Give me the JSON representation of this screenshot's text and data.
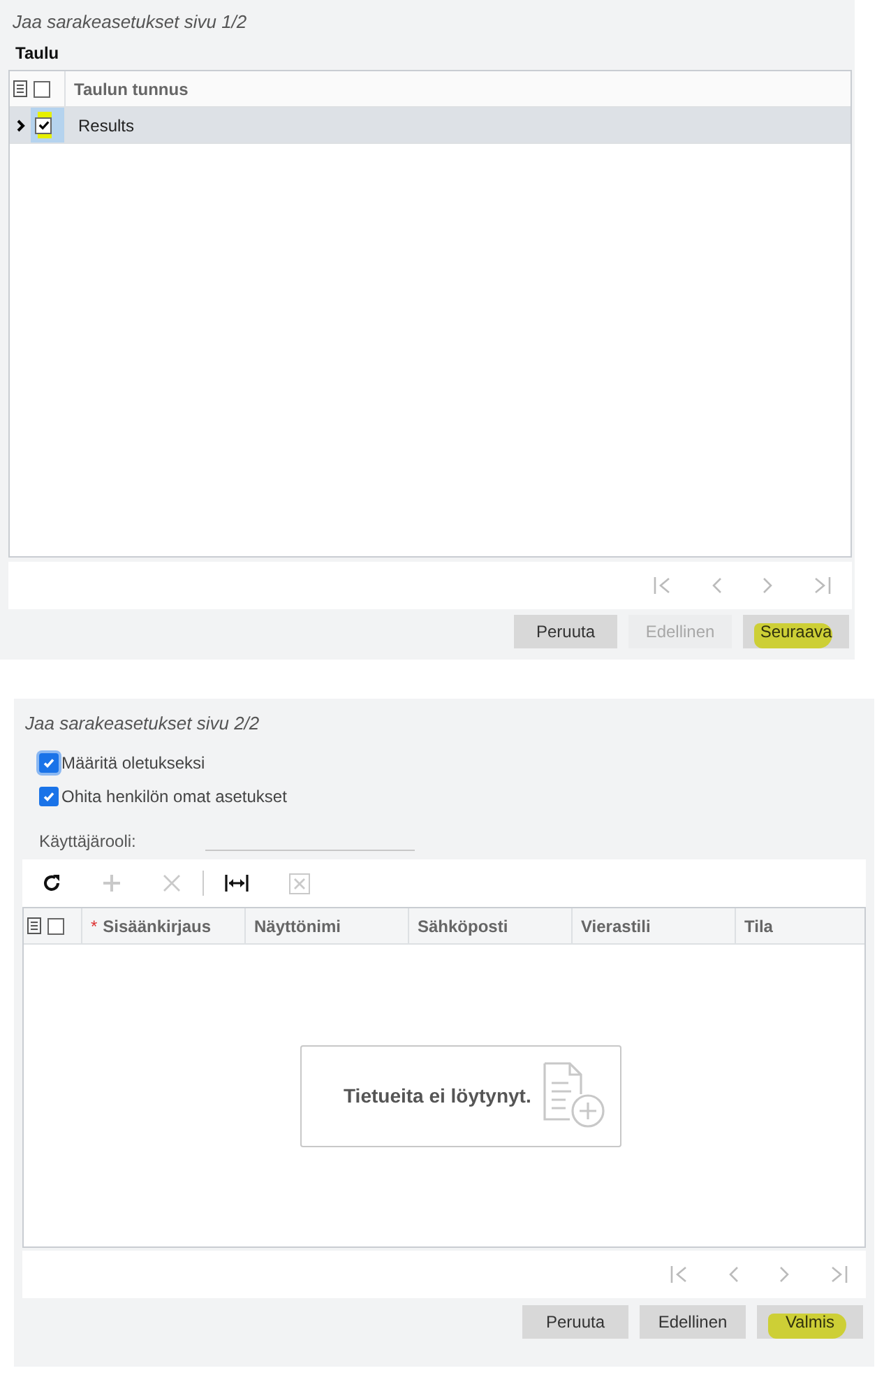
{
  "step1": {
    "title": "Jaa sarakeasetukset sivu 1/2",
    "section": "Taulu",
    "table": {
      "columns": [
        "Taulun tunnus"
      ],
      "all_checked": false,
      "rows": [
        {
          "expanded": false,
          "checked": true,
          "selected": true,
          "highlighted": true,
          "cells": [
            "Results"
          ]
        }
      ]
    },
    "buttons": [
      {
        "label": "Peruuta",
        "disabled": false,
        "highlighted": false
      },
      {
        "label": "Edellinen",
        "disabled": true,
        "highlighted": false
      },
      {
        "label": "Seuraava",
        "disabled": false,
        "highlighted": true
      }
    ]
  },
  "step2": {
    "title": "Jaa sarakeasetukset sivu 2/2",
    "options": [
      {
        "label": "Määritä oletukseksi",
        "checked": true,
        "focused": true
      },
      {
        "label": "Ohita henkilön omat asetukset",
        "checked": true,
        "focused": false
      }
    ],
    "role_field": {
      "label": "Käyttäjärooli:"
    },
    "toolbar": [
      {
        "kind": "refresh",
        "disabled": false
      },
      {
        "kind": "add",
        "disabled": true
      },
      {
        "kind": "delete",
        "disabled": true
      },
      {
        "kind": "separator"
      },
      {
        "kind": "fit",
        "disabled": false
      },
      {
        "kind": "export",
        "disabled": true
      }
    ],
    "table": {
      "all_checked": false,
      "columns": [
        {
          "label": "Sisäänkirjaus",
          "required_mark": "*"
        },
        {
          "label": "Näyttönimi"
        },
        {
          "label": "Sähköposti"
        },
        {
          "label": "Vierastili"
        },
        {
          "label": "Tila"
        }
      ],
      "empty_message": "Tietueita ei löytynyt."
    },
    "buttons": [
      {
        "label": "Peruuta",
        "disabled": false,
        "highlighted": false
      },
      {
        "label": "Edellinen",
        "disabled": false,
        "highlighted": false
      },
      {
        "label": "Valmis",
        "disabled": false,
        "highlighted": true
      }
    ]
  }
}
